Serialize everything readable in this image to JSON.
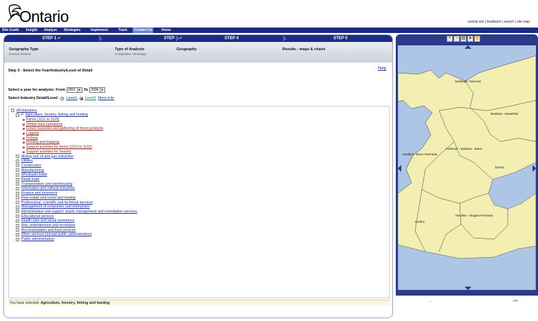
{
  "header": {
    "logo_text": "Ontario",
    "top_links": "central site | feedback | search | site map"
  },
  "nav": {
    "items": [
      "Site Guide",
      "Insight",
      "Analyze",
      "Strategies",
      "Implement",
      "Track",
      "Contact Us",
      "Home"
    ],
    "active": "Contact Us"
  },
  "steps": {
    "step1": "STEP 1 ✓",
    "step2": "STEP 2 ✓",
    "step4": "STEP 4",
    "step5": "STEP 5"
  },
  "summary": {
    "geo_title": "Geography Type",
    "geo_value": "Census Division",
    "analysis_title": "Type of Analysis",
    "analysis_value": "Competitive Advantage",
    "geography_title": "Geography",
    "results_title": "Results - maps & charts"
  },
  "main": {
    "step_title": "Step 3 - Select the Year/Industry/Level of Detail",
    "help_label": "Help",
    "year_label": "Select a year for analysis: From",
    "year_from": "2001",
    "to_label": "To",
    "year_to": "2006",
    "level_label": "Select Industry Detail/Level:",
    "level1": "Level1",
    "level2": "Level2",
    "more_info": "More Info"
  },
  "tree": {
    "root": "All Industries",
    "expanded": "Agriculture, forestry, fishing and hunting",
    "children": [
      "Farms (1111 to 1129)",
      "Timber tract operations",
      "Forest nurseries and gathering of forest products",
      "Logging",
      "Fishing",
      "Hunting and trapping",
      "Support activities for farms (1151 to 1152)",
      "Support activities for forestry"
    ],
    "industries": [
      "Mining and oil and gas extraction",
      "Utilities",
      "Construction",
      "Manufacturing",
      "Wholesale trade",
      "Retail trade",
      "Transportation and warehousing",
      "Information and cultural industries",
      "Finance and insurance",
      "Real estate and rental and leasing",
      "Professional, scientific and technical services",
      "Management of companies and enterprises",
      "Administrative and support, waste management and remediation services",
      "Educational services",
      "Health care and social assistance",
      "Arts, entertainment and recreation",
      "Accommodation and food services",
      "Other services (except public administration)",
      "Public administration"
    ]
  },
  "status": {
    "prefix": "You have selected:",
    "selection": "Agriculture, forestry, fishing and hunting"
  },
  "map": {
    "labels": [
      "Northeast / Nord-est",
      "Muskoka - Kawarthas",
      "Kitchener - Waterloo - Barrie",
      "Stratford - Bruce Peninsula",
      "Toronto",
      "London",
      "Hamilton - Niagara Peninsula"
    ],
    "footer_left": "...",
    "footer_right": "ert."
  },
  "colors": {
    "nav_bg": "#1b2c82",
    "land": "#f3efb2",
    "water": "#adc6e6"
  }
}
